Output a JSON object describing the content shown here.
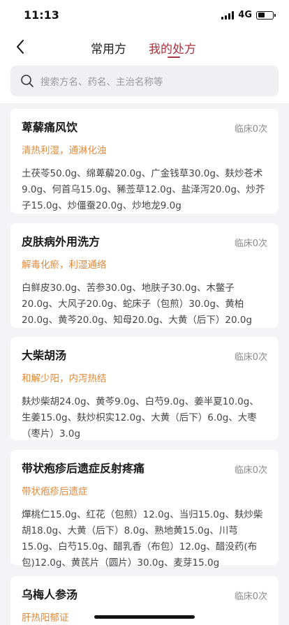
{
  "status": {
    "time": "11:13",
    "network": "4G"
  },
  "nav": {
    "tabs": [
      {
        "label": "常用方",
        "active": false
      },
      {
        "label": "我的处方",
        "active": true
      }
    ]
  },
  "search": {
    "placeholder": "搜索方名、药名、主治名称等"
  },
  "colors": {
    "accent": "#a8323d",
    "effect": "#e08a3c",
    "background": "#f4f4f6"
  },
  "prescriptions": [
    {
      "name": "萆薢痛风饮",
      "count": "临床0次",
      "effect": "清热利湿，通淋化浊",
      "herbs": "土茯苓50.0g、绵萆薢20.0g、广金钱草30.0g、麸炒苍术9.0g、何首乌15.0g、豨莶草12.0g、盐泽泻20.0g、炒芥子15.0g、炒僵蚕20.0g、炒地龙9.0g"
    },
    {
      "name": "皮肤病外用洗方",
      "count": "临床0次",
      "effect": "解毒化瘀，利湿通络",
      "herbs": "白鲜皮30.0g、苦参30.0g、地肤子30.0g、木鳖子20.0g、大风子20.0g、蛇床子（包煎）30.0g、黄柏20.0g、黄芩20.0g、知母20.0g、大黄（后下）20.0g"
    },
    {
      "name": "大柴胡汤",
      "count": "临床0次",
      "effect": "和解少阳，内泻热结",
      "herbs": "麸炒柴胡24.0g、黄芩9.0g、白芍9.0g、姜半夏10.0g、生姜15.0g、麸炒枳实12.0g、大黄（后下）6.0g、大枣（枣片）3.0g"
    },
    {
      "name": "带状疱疹后遗症反射疼痛",
      "count": "临床0次",
      "effect": "带状疱疹后遗症",
      "herbs": "燀桃仁15.0g、红花（包煎）12.0g、当归15.0g、麸炒柴胡18.0g、大黄（后下）8.0g、熟地黄15.0g、川芎15.0g、白芍15.0g、醋乳香（布包）12.0g、醋没药(布包)12.0g、黄芪片（圆片）30.0g、麦芽15.0g"
    },
    {
      "name": "乌梅人参汤",
      "count": "临床0次",
      "effect": "肝热阳郁证",
      "herbs": ""
    }
  ]
}
